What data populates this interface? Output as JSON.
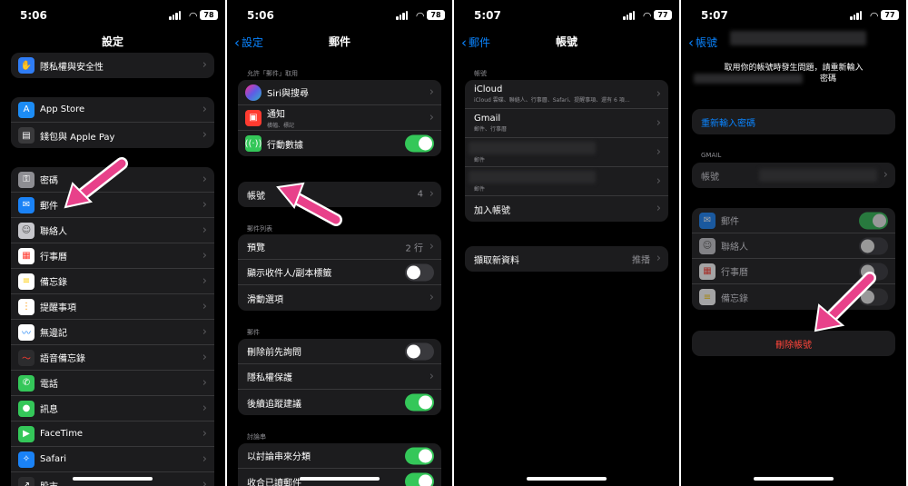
{
  "colors": {
    "accent": "#0a84ff",
    "green": "#34c759",
    "destructive": "#ff453a",
    "arrow": "#e8418a"
  },
  "panels": [
    {
      "status": {
        "time": "5:06",
        "battery": "78"
      },
      "nav_title": "設定",
      "group1": [
        {
          "label": "隱私權與安全性",
          "icon": "hand-icon",
          "color": "#2f7df6"
        }
      ],
      "group2": [
        {
          "label": "App Store",
          "icon": "app-store-icon",
          "color": "#1c8cf5"
        },
        {
          "label": "錢包與 Apple Pay",
          "icon": "wallet-icon",
          "color": "#2c2c2e"
        }
      ],
      "group3": [
        {
          "label": "密碼",
          "icon": "key-icon",
          "color": "#8e8e93"
        },
        {
          "label": "郵件",
          "icon": "mail-icon",
          "color": "#1a82f6"
        },
        {
          "label": "聯絡人",
          "icon": "contacts-icon",
          "color": "#8e8e93"
        },
        {
          "label": "行事曆",
          "icon": "calendar-icon",
          "color": "#ffffff"
        },
        {
          "label": "備忘錄",
          "icon": "notes-icon",
          "color": "#ffcc00"
        },
        {
          "label": "提醒事項",
          "icon": "reminders-icon",
          "color": "#ffffff"
        },
        {
          "label": "無邊記",
          "icon": "freeform-icon",
          "color": "#ffffff"
        },
        {
          "label": "語音備忘錄",
          "icon": "voice-memos-icon",
          "color": "#1c1c1e"
        },
        {
          "label": "電話",
          "icon": "phone-icon",
          "color": "#34c759"
        },
        {
          "label": "訊息",
          "icon": "messages-icon",
          "color": "#34c759"
        },
        {
          "label": "FaceTime",
          "icon": "facetime-icon",
          "color": "#34c759"
        },
        {
          "label": "Safari",
          "icon": "safari-icon",
          "color": "#1a82f6"
        },
        {
          "label": "股市",
          "icon": "stocks-icon",
          "color": "#1c1c1e"
        }
      ]
    },
    {
      "status": {
        "time": "5:06",
        "battery": "78"
      },
      "back": "設定",
      "nav_title": "郵件",
      "allow_header": "允許「郵件」取用",
      "allow_rows": [
        {
          "label": "Siri與搜尋",
          "icon": "siri-icon",
          "color": "#5e5ce6"
        },
        {
          "label": "通知",
          "sub": "橫幅、標記",
          "icon": "notifications-icon",
          "color": "#ff3b30"
        },
        {
          "label": "行動數據",
          "icon": "cellular-icon",
          "color": "#34c759",
          "toggle": true
        }
      ],
      "accounts_row": {
        "label": "帳號",
        "value": "4"
      },
      "list_header": "郵件列表",
      "list_rows": [
        {
          "label": "預覽",
          "value": "2 行"
        },
        {
          "label": "顯示收件人/副本標籤",
          "toggle": false
        },
        {
          "label": "滑動選項"
        }
      ],
      "mail_header": "郵件",
      "mail_rows": [
        {
          "label": "刪除前先詢問",
          "toggle": false
        },
        {
          "label": "隱私權保護"
        },
        {
          "label": "後續追蹤建議",
          "toggle": true
        }
      ],
      "thread_header": "討論串",
      "thread_rows": [
        {
          "label": "以討論串來分類",
          "toggle": true
        },
        {
          "label": "收合已讀郵件",
          "toggle": true
        }
      ]
    },
    {
      "status": {
        "time": "5:07",
        "battery": "77"
      },
      "back": "郵件",
      "nav_title": "帳號",
      "accounts_header": "帳號",
      "accounts": [
        {
          "label": "iCloud",
          "sub": "iCloud 雲碟、聯絡人、行事曆、Safari、提醒事項、還有 6 項…"
        },
        {
          "label": "Gmail",
          "sub": "郵件、行事曆"
        },
        {
          "label": "",
          "sub": "郵件"
        },
        {
          "label": "",
          "sub": "郵件"
        }
      ],
      "add_account": "加入帳號",
      "fetch": {
        "label": "擷取新資料",
        "value": "推播"
      }
    },
    {
      "status": {
        "time": "5:07",
        "battery": "77"
      },
      "back": "帳號",
      "message_line1": "取用你的帳號時發生問題，請重新輸入",
      "message_line2": "密碼",
      "reenter": "重新輸入密碼",
      "gmail_header": "GMAIL",
      "account_label": "帳號",
      "services": [
        {
          "label": "郵件",
          "icon": "mail-icon",
          "color": "#1a82f6",
          "on": true
        },
        {
          "label": "聯絡人",
          "icon": "contacts-icon",
          "color": "#8e8e93",
          "on": false
        },
        {
          "label": "行事曆",
          "icon": "calendar-icon",
          "color": "#ffffff",
          "on": false
        },
        {
          "label": "備忘錄",
          "icon": "notes-icon",
          "color": "#ffcc00",
          "on": false
        }
      ],
      "delete": "刪除帳號"
    }
  ]
}
